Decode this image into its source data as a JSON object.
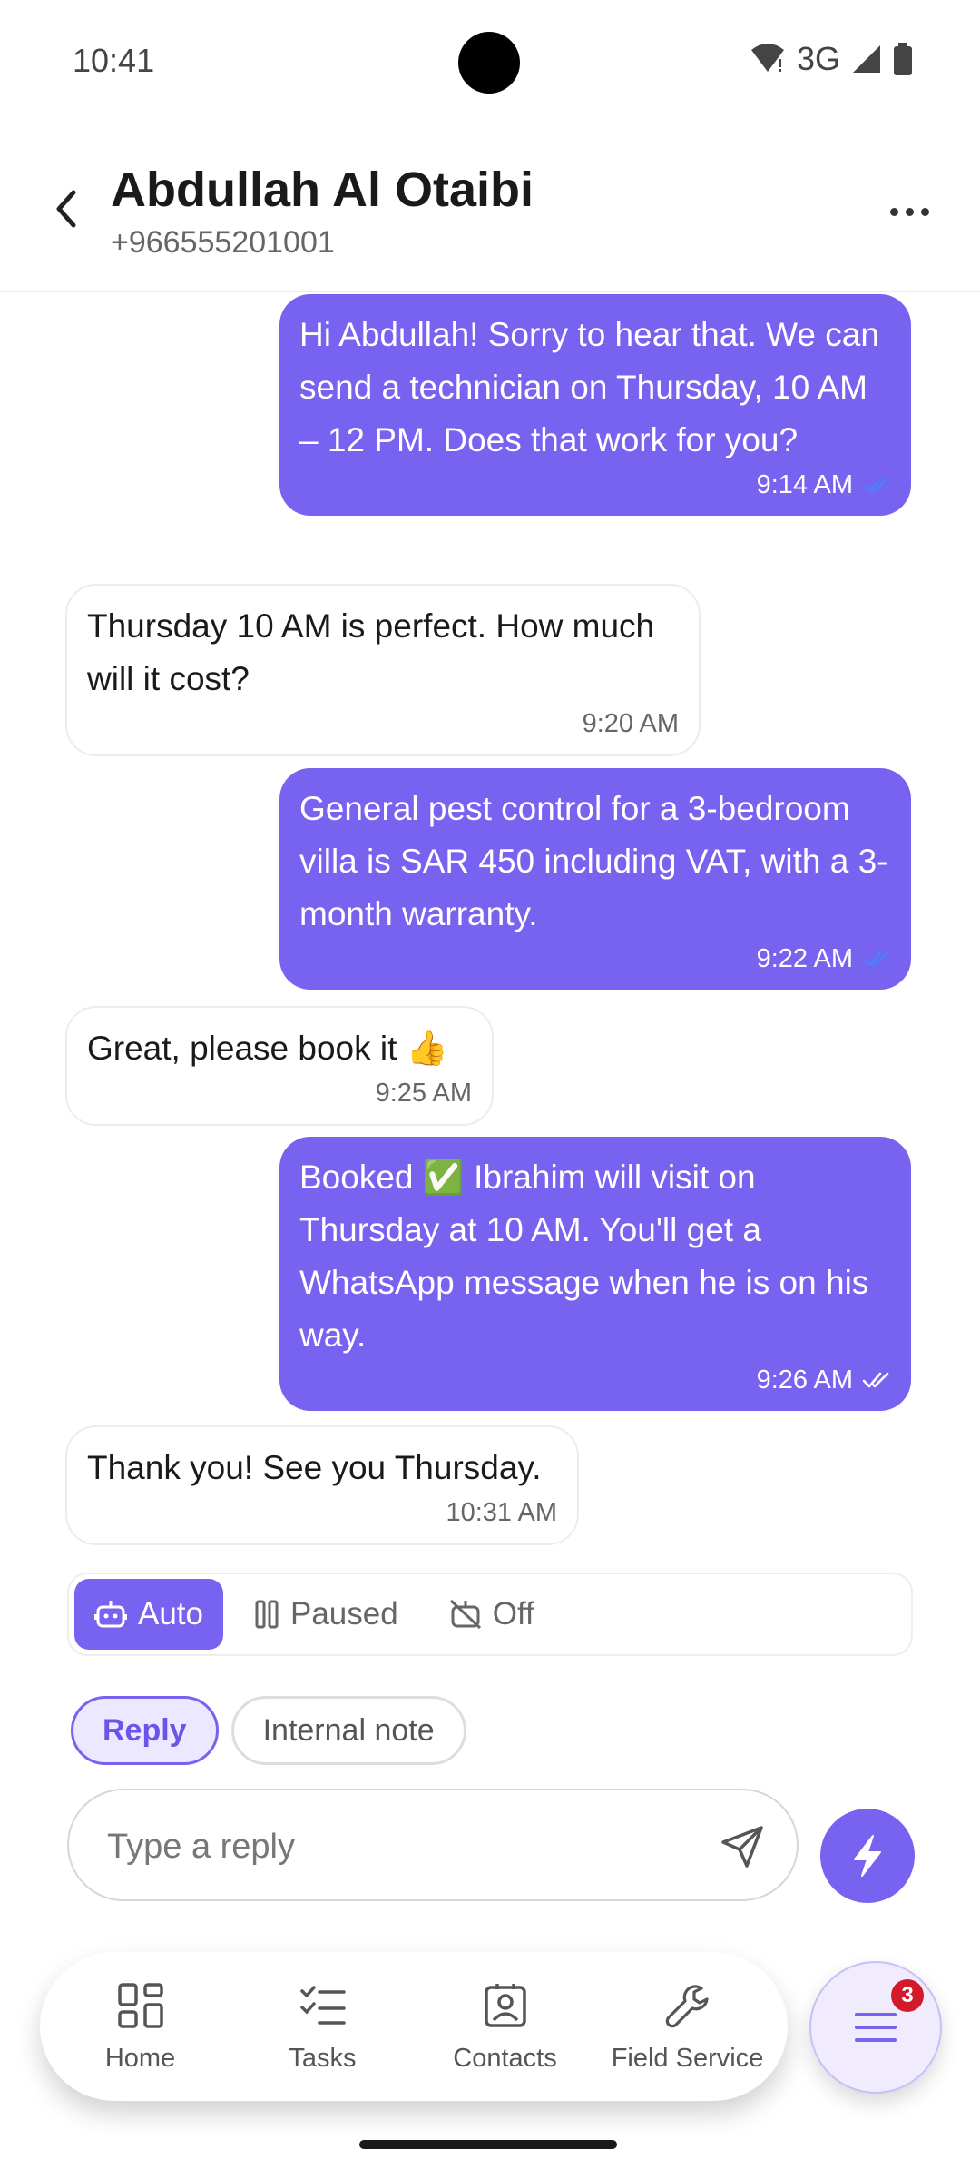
{
  "status_bar": {
    "time": "10:41",
    "network": "3G"
  },
  "header": {
    "contact_name": "Abdullah Al Otaibi",
    "contact_phone": "+966555201001"
  },
  "messages": [
    {
      "direction": "out",
      "text": "Hi Abdullah! Sorry to hear that. We can send a technician on Thursday, 10 AM – 12 PM. Does that work for you?",
      "time": "9:14 AM",
      "status": "read"
    },
    {
      "direction": "in",
      "text": "Thursday 10 AM is perfect. How much will it cost?",
      "time": "9:20 AM"
    },
    {
      "direction": "out",
      "text": "General pest control for a 3-bedroom villa is SAR 450 including VAT, with a 3-month warranty.",
      "time": "9:22 AM",
      "status": "read"
    },
    {
      "direction": "in",
      "text": "Great, please book it 👍",
      "time": "9:25 AM"
    },
    {
      "direction": "out",
      "text": "Booked ✅ Ibrahim will visit on Thursday at 10 AM. You'll get a WhatsApp message when he is on his way.",
      "time": "9:26 AM",
      "status": "delivered"
    },
    {
      "direction": "in",
      "text": "Thank you! See you Thursday.",
      "time": "10:31 AM"
    }
  ],
  "mode_selector": {
    "selected": "Auto",
    "options": [
      "Auto",
      "Paused",
      "Off"
    ]
  },
  "reply_tabs": {
    "selected": "Reply",
    "options": [
      "Reply",
      "Internal note"
    ]
  },
  "composer": {
    "placeholder": "Type a reply"
  },
  "bottom_nav": {
    "items": [
      "Home",
      "Tasks",
      "Contacts",
      "Field Service"
    ]
  },
  "menu_fab": {
    "badge_count": "3"
  },
  "colors": {
    "accent": "#7763f0",
    "read_tick": "#4a80ff",
    "badge": "#d21b2a"
  },
  "icons": {
    "back": "chevron-left-icon",
    "more": "more-horizontal-icon",
    "send": "send-icon",
    "quick_action": "bolt-icon",
    "menu": "menu-icon",
    "auto": "robot-icon",
    "paused": "pause-icon",
    "off": "bot-off-icon",
    "home": "grid-icon",
    "tasks": "checklist-icon",
    "contacts": "contact-card-icon",
    "field_service": "wrench-icon"
  }
}
